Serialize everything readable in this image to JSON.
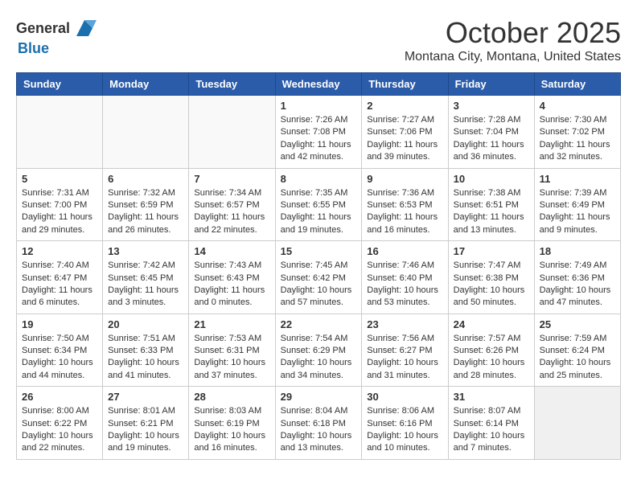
{
  "header": {
    "logo_general": "General",
    "logo_blue": "Blue",
    "month": "October 2025",
    "location": "Montana City, Montana, United States"
  },
  "weekdays": [
    "Sunday",
    "Monday",
    "Tuesday",
    "Wednesday",
    "Thursday",
    "Friday",
    "Saturday"
  ],
  "weeks": [
    [
      {
        "day": "",
        "info": ""
      },
      {
        "day": "",
        "info": ""
      },
      {
        "day": "",
        "info": ""
      },
      {
        "day": "1",
        "info": "Sunrise: 7:26 AM\nSunset: 7:08 PM\nDaylight: 11 hours and 42 minutes."
      },
      {
        "day": "2",
        "info": "Sunrise: 7:27 AM\nSunset: 7:06 PM\nDaylight: 11 hours and 39 minutes."
      },
      {
        "day": "3",
        "info": "Sunrise: 7:28 AM\nSunset: 7:04 PM\nDaylight: 11 hours and 36 minutes."
      },
      {
        "day": "4",
        "info": "Sunrise: 7:30 AM\nSunset: 7:02 PM\nDaylight: 11 hours and 32 minutes."
      }
    ],
    [
      {
        "day": "5",
        "info": "Sunrise: 7:31 AM\nSunset: 7:00 PM\nDaylight: 11 hours and 29 minutes."
      },
      {
        "day": "6",
        "info": "Sunrise: 7:32 AM\nSunset: 6:59 PM\nDaylight: 11 hours and 26 minutes."
      },
      {
        "day": "7",
        "info": "Sunrise: 7:34 AM\nSunset: 6:57 PM\nDaylight: 11 hours and 22 minutes."
      },
      {
        "day": "8",
        "info": "Sunrise: 7:35 AM\nSunset: 6:55 PM\nDaylight: 11 hours and 19 minutes."
      },
      {
        "day": "9",
        "info": "Sunrise: 7:36 AM\nSunset: 6:53 PM\nDaylight: 11 hours and 16 minutes."
      },
      {
        "day": "10",
        "info": "Sunrise: 7:38 AM\nSunset: 6:51 PM\nDaylight: 11 hours and 13 minutes."
      },
      {
        "day": "11",
        "info": "Sunrise: 7:39 AM\nSunset: 6:49 PM\nDaylight: 11 hours and 9 minutes."
      }
    ],
    [
      {
        "day": "12",
        "info": "Sunrise: 7:40 AM\nSunset: 6:47 PM\nDaylight: 11 hours and 6 minutes."
      },
      {
        "day": "13",
        "info": "Sunrise: 7:42 AM\nSunset: 6:45 PM\nDaylight: 11 hours and 3 minutes."
      },
      {
        "day": "14",
        "info": "Sunrise: 7:43 AM\nSunset: 6:43 PM\nDaylight: 11 hours and 0 minutes."
      },
      {
        "day": "15",
        "info": "Sunrise: 7:45 AM\nSunset: 6:42 PM\nDaylight: 10 hours and 57 minutes."
      },
      {
        "day": "16",
        "info": "Sunrise: 7:46 AM\nSunset: 6:40 PM\nDaylight: 10 hours and 53 minutes."
      },
      {
        "day": "17",
        "info": "Sunrise: 7:47 AM\nSunset: 6:38 PM\nDaylight: 10 hours and 50 minutes."
      },
      {
        "day": "18",
        "info": "Sunrise: 7:49 AM\nSunset: 6:36 PM\nDaylight: 10 hours and 47 minutes."
      }
    ],
    [
      {
        "day": "19",
        "info": "Sunrise: 7:50 AM\nSunset: 6:34 PM\nDaylight: 10 hours and 44 minutes."
      },
      {
        "day": "20",
        "info": "Sunrise: 7:51 AM\nSunset: 6:33 PM\nDaylight: 10 hours and 41 minutes."
      },
      {
        "day": "21",
        "info": "Sunrise: 7:53 AM\nSunset: 6:31 PM\nDaylight: 10 hours and 37 minutes."
      },
      {
        "day": "22",
        "info": "Sunrise: 7:54 AM\nSunset: 6:29 PM\nDaylight: 10 hours and 34 minutes."
      },
      {
        "day": "23",
        "info": "Sunrise: 7:56 AM\nSunset: 6:27 PM\nDaylight: 10 hours and 31 minutes."
      },
      {
        "day": "24",
        "info": "Sunrise: 7:57 AM\nSunset: 6:26 PM\nDaylight: 10 hours and 28 minutes."
      },
      {
        "day": "25",
        "info": "Sunrise: 7:59 AM\nSunset: 6:24 PM\nDaylight: 10 hours and 25 minutes."
      }
    ],
    [
      {
        "day": "26",
        "info": "Sunrise: 8:00 AM\nSunset: 6:22 PM\nDaylight: 10 hours and 22 minutes."
      },
      {
        "day": "27",
        "info": "Sunrise: 8:01 AM\nSunset: 6:21 PM\nDaylight: 10 hours and 19 minutes."
      },
      {
        "day": "28",
        "info": "Sunrise: 8:03 AM\nSunset: 6:19 PM\nDaylight: 10 hours and 16 minutes."
      },
      {
        "day": "29",
        "info": "Sunrise: 8:04 AM\nSunset: 6:18 PM\nDaylight: 10 hours and 13 minutes."
      },
      {
        "day": "30",
        "info": "Sunrise: 8:06 AM\nSunset: 6:16 PM\nDaylight: 10 hours and 10 minutes."
      },
      {
        "day": "31",
        "info": "Sunrise: 8:07 AM\nSunset: 6:14 PM\nDaylight: 10 hours and 7 minutes."
      },
      {
        "day": "",
        "info": ""
      }
    ]
  ]
}
